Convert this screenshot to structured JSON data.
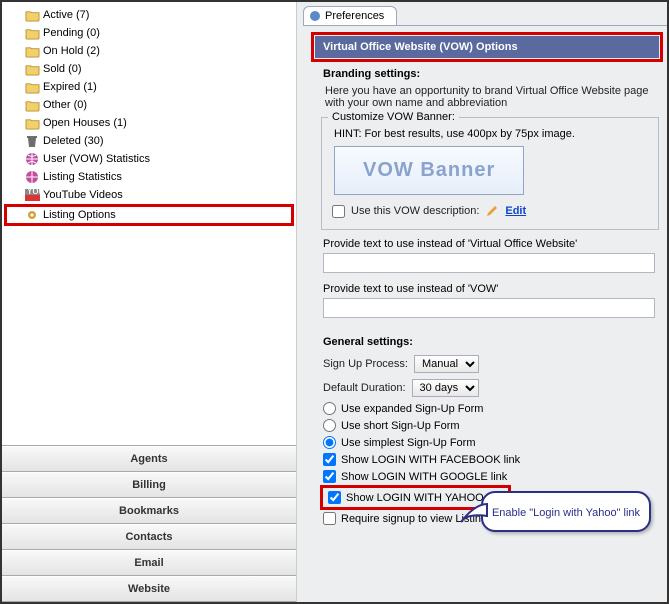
{
  "tree": {
    "items": [
      {
        "label": "Active (7)",
        "icon": "folder"
      },
      {
        "label": "Pending (0)",
        "icon": "folder"
      },
      {
        "label": "On Hold (2)",
        "icon": "folder"
      },
      {
        "label": "Sold (0)",
        "icon": "folder"
      },
      {
        "label": "Expired (1)",
        "icon": "folder"
      },
      {
        "label": "Other (0)",
        "icon": "folder"
      },
      {
        "label": "Open Houses (1)",
        "icon": "folder"
      },
      {
        "label": "Deleted (30)",
        "icon": "trash"
      },
      {
        "label": "User (VOW) Statistics",
        "icon": "globe"
      },
      {
        "label": "Listing Statistics",
        "icon": "globe"
      },
      {
        "label": "YouTube Videos",
        "icon": "youtube"
      },
      {
        "label": "Listing Options",
        "icon": "gear",
        "highlight": true
      }
    ]
  },
  "nav": [
    "Agents",
    "Billing",
    "Bookmarks",
    "Contacts",
    "Email",
    "Website"
  ],
  "prefs": {
    "tab_label": "Preferences",
    "section_title": "Virtual Office Website (VOW) Options",
    "branding_title": "Branding settings:",
    "branding_hint": "Here you have an opportunity to brand Virtual Office Website page with your own name and abbreviation",
    "customize_legend": "Customize VOW Banner:",
    "banner_hint": "HINT: For best results, use 400px by 75px image.",
    "banner_text": "VOW Banner",
    "use_desc_label": "Use this VOW description:",
    "edit_label": "Edit",
    "provide1": "Provide text to use instead of 'Virtual Office Website'",
    "provide2": "Provide text to use instead of 'VOW'",
    "general_title": "General settings:",
    "signup_label": "Sign Up Process:",
    "signup_value": "Manual",
    "duration_label": "Default Duration:",
    "duration_value": "30 days",
    "radio1": "Use expanded Sign-Up Form",
    "radio2": "Use short Sign-Up Form",
    "radio3": "Use simplest Sign-Up Form",
    "check_fb": "Show LOGIN WITH FACEBOOK link",
    "check_google": "Show LOGIN WITH GOOGLE link",
    "check_yahoo": "Show LOGIN WITH YAHOO link",
    "check_require": "Require signup to view Listing Details"
  },
  "callout": "Enable \"Login with Yahoo\" link"
}
